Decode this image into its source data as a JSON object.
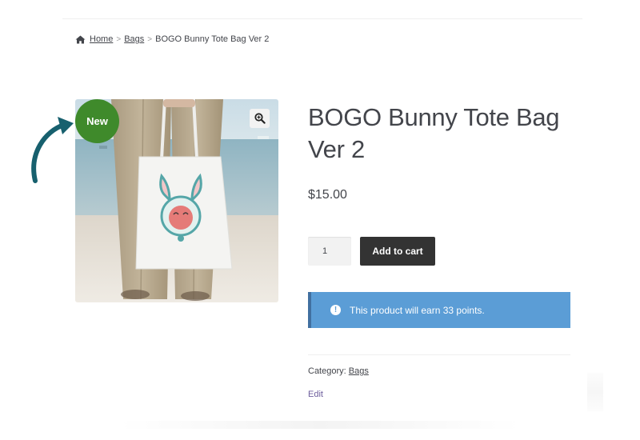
{
  "breadcrumb": {
    "home": "Home",
    "separator": ">",
    "category": "Bags",
    "current": "BOGO Bunny Tote Bag Ver 2"
  },
  "product": {
    "title": "BOGO Bunny Tote Bag Ver 2",
    "price": "$15.00",
    "badge": "New",
    "image_icon": "bunny-tote-bag-photo"
  },
  "cart": {
    "quantity": "1",
    "add_label": "Add to cart"
  },
  "notice": {
    "text": "This product will earn 33 points.",
    "icon": "info-icon"
  },
  "meta": {
    "category_label": "Category:",
    "category_link": "Bags",
    "edit_label": "Edit"
  },
  "colors": {
    "badge_green": "#3f8a2b",
    "notice_blue": "#5b9dd6",
    "button_dark": "#333333",
    "arrow_teal": "#17606e",
    "edit_purple": "#6d5d9c"
  }
}
